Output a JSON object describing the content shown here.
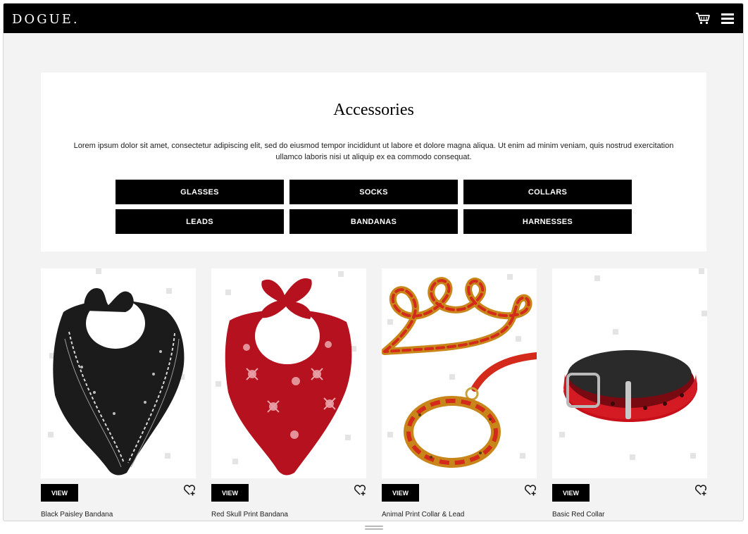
{
  "header": {
    "logo": "DOGUE.",
    "cart_icon": "cart-icon",
    "menu_icon": "hamburger-menu-icon"
  },
  "intro": {
    "title": "Accessories",
    "description": "Lorem ipsum dolor sit amet, consectetur adipiscing elit, sed do eiusmod tempor incididunt ut labore et dolore magna aliqua. Ut enim ad minim veniam, quis nostrud exercitation ullamco laboris nisi ut aliquip ex ea commodo consequat."
  },
  "categories": [
    "GLASSES",
    "SOCKS",
    "COLLARS",
    "LEADS",
    "BANDANAS",
    "HARNESSES"
  ],
  "products": [
    {
      "name": "Black Paisley Bandana",
      "view_label": "VIEW",
      "color": "#1d1d1d"
    },
    {
      "name": "Red Skull Print Bandana",
      "view_label": "VIEW",
      "color": "#b5111e"
    },
    {
      "name": "Animal Print Collar & Lead",
      "view_label": "VIEW",
      "color": "#d42a1c"
    },
    {
      "name": "Basic Red Collar",
      "view_label": "VIEW",
      "color": "#c8101b"
    }
  ],
  "colors": {
    "topbar": "#000000",
    "page_bg": "#f3f3f3",
    "panel_bg": "#ffffff",
    "button_bg": "#000000"
  }
}
